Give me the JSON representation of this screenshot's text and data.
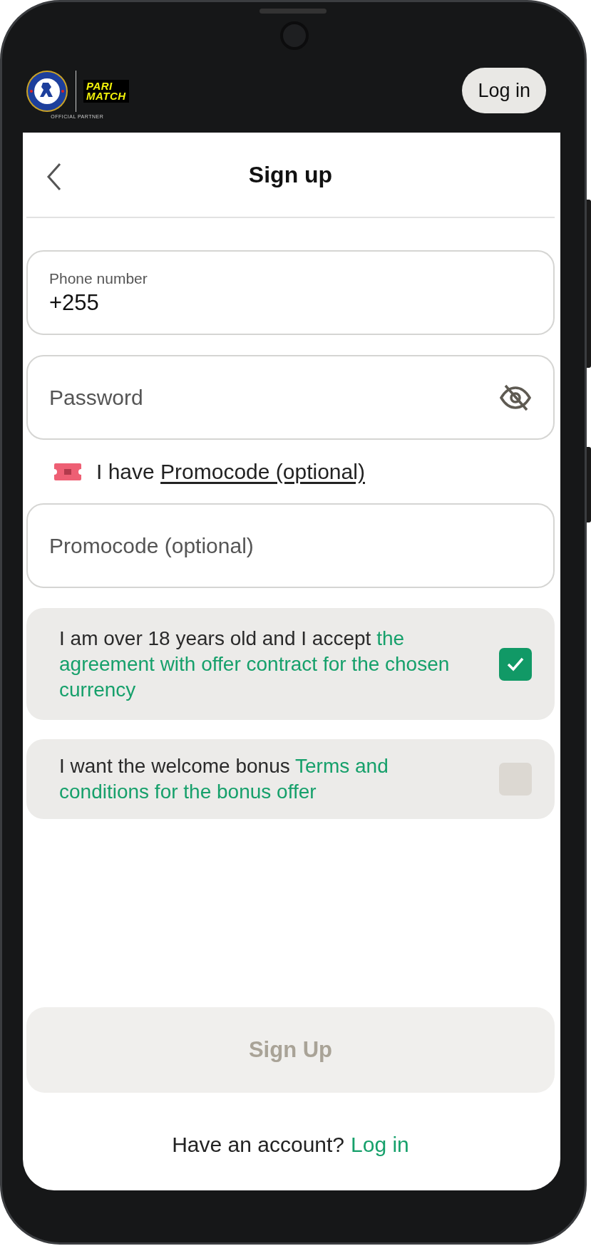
{
  "header": {
    "brand_lines": [
      "PARI",
      "MATCH"
    ],
    "partner_label": "OFFICIAL PARTNER",
    "login_button": "Log in"
  },
  "nav": {
    "title": "Sign up"
  },
  "fields": [
    {
      "kind": "phone",
      "label": "Phone number",
      "value": "+255"
    },
    {
      "kind": "password",
      "placeholder": "Password"
    }
  ],
  "promo_toggle": {
    "prefix": "I have",
    "link": "Promocode (optional)"
  },
  "promo_field": {
    "placeholder": "Promocode (optional)"
  },
  "consents": [
    {
      "text": "I am over 18 years old and I accept",
      "link": "the agreement with offer contract for the chosen currency",
      "checked": true
    },
    {
      "text": "I want the welcome bonus",
      "link": "Terms and conditions for the bonus offer",
      "checked": false
    }
  ],
  "submit": {
    "label": "Sign Up",
    "disabled": true
  },
  "footer": {
    "text": "Have an account?",
    "link": "Log in"
  }
}
